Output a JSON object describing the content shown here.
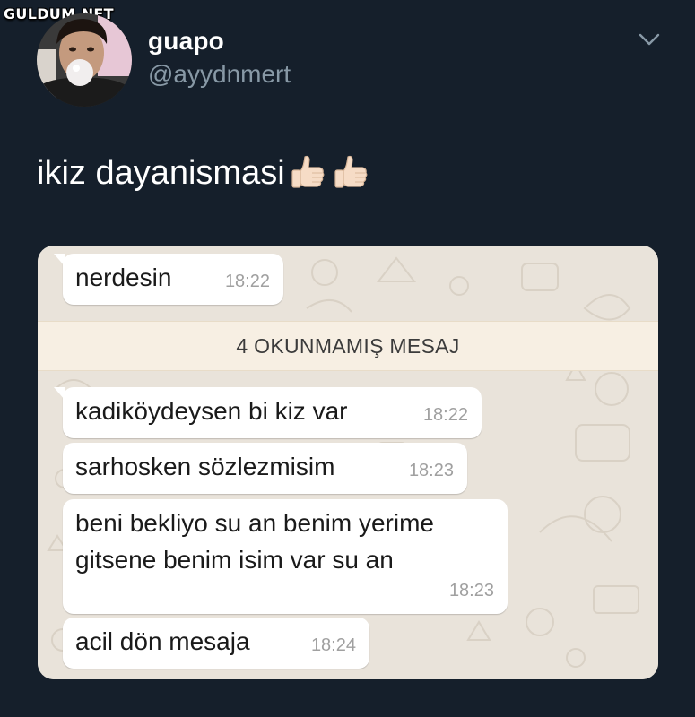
{
  "watermark": "GULDUM.NET",
  "tweet": {
    "display_name": "guapo",
    "handle": "@ayydnmert",
    "text": "ikiz dayanismasi"
  },
  "icons": {
    "menu": "chevron-down-icon",
    "emoji": "thumbs-up-icon"
  },
  "chat": {
    "unread_label": "4 OKUNMAMIŞ MESAJ",
    "messages": [
      {
        "lines": [
          "nerdesin"
        ],
        "time": "18:22"
      },
      {
        "lines": [
          "kadiköydeysen bi kiz var"
        ],
        "time": "18:22"
      },
      {
        "lines": [
          "sarhosken sözlezmisim"
        ],
        "time": "18:23"
      },
      {
        "lines": [
          "beni bekliyo su an benim yerime",
          "gitsene benim isim var su an"
        ],
        "time": "18:23"
      },
      {
        "lines": [
          "acil dön mesaja"
        ],
        "time": "18:24"
      }
    ]
  },
  "colors": {
    "background": "#151f2b",
    "handle": "#8899a6",
    "chat_wallpaper": "#e9e3da",
    "unread_bar": "#f7efe3"
  }
}
